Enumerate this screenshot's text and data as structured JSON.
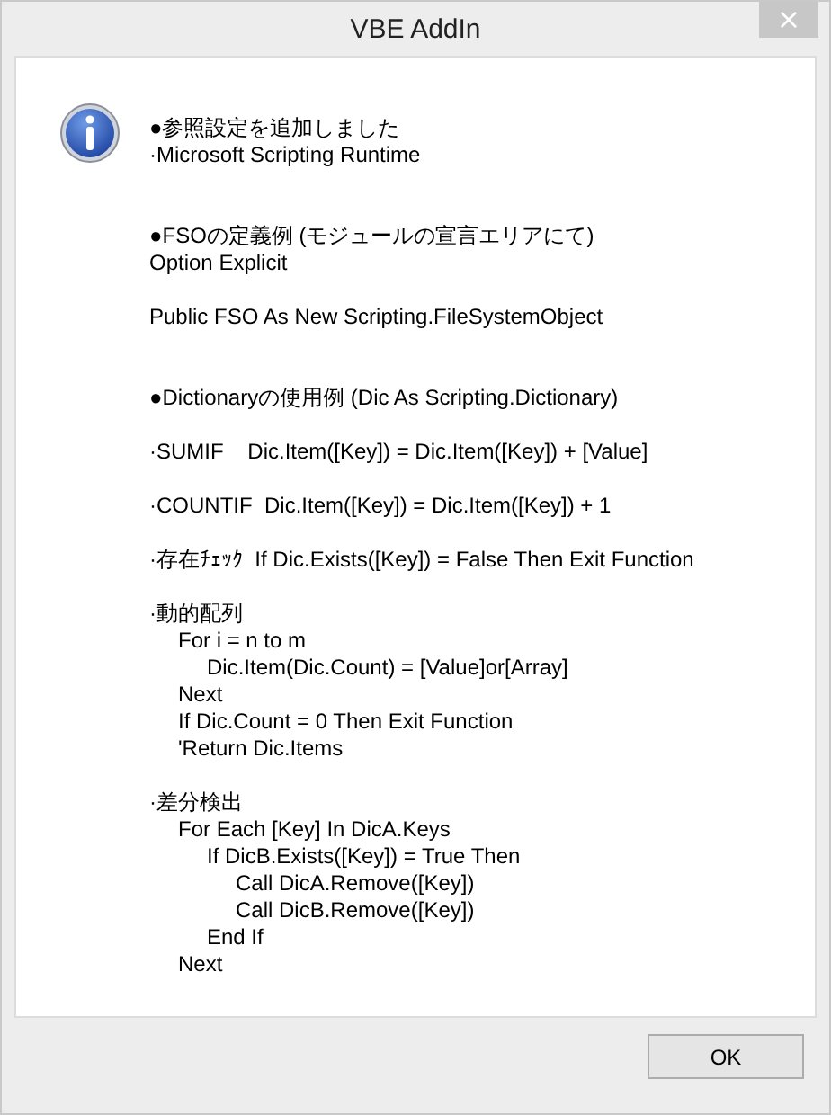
{
  "window": {
    "title": "VBE AddIn",
    "close": "×"
  },
  "message": {
    "sections": [
      {
        "paragraphs": [
          [
            {
              "text": "●参照設定を追加しました"
            },
            {
              "text": "·Microsoft Scripting Runtime"
            }
          ]
        ]
      },
      {
        "paragraphs": [
          [
            {
              "text": "●FSOの定義例 (モジュールの宣言エリアにて)"
            },
            {
              "text": "Option Explicit"
            }
          ],
          [
            {
              "text": "Public FSO As New Scripting.FileSystemObject"
            }
          ]
        ]
      },
      {
        "paragraphs": [
          [
            {
              "text": "●Dictionaryの使用例 (Dic As Scripting.Dictionary)"
            }
          ],
          [
            {
              "text": "·SUMIF    Dic.Item([Key]) = Dic.Item([Key]) + [Value]"
            }
          ],
          [
            {
              "text": "·COUNTIF  Dic.Item([Key]) = Dic.Item([Key]) + 1"
            }
          ],
          [
            {
              "text": "·存在ﾁｪｯｸ  If Dic.Exists([Key]) = False Then Exit Function"
            }
          ],
          [
            {
              "text": "·動的配列",
              "children": [
                {
                  "text": "For i = n to m",
                  "children": [
                    {
                      "text": "Dic.Item(Dic.Count) = [Value]or[Array]"
                    }
                  ]
                },
                {
                  "text": "Next"
                },
                {
                  "text": "If Dic.Count = 0 Then Exit Function"
                },
                {
                  "text": "'Return Dic.Items"
                }
              ]
            }
          ],
          [
            {
              "text": "·差分検出",
              "children": [
                {
                  "text": "For Each [Key] In DicA.Keys",
                  "children": [
                    {
                      "text": "If DicB.Exists([Key]) = True Then",
                      "children": [
                        {
                          "text": "Call DicA.Remove([Key])"
                        },
                        {
                          "text": "Call DicB.Remove([Key])"
                        }
                      ]
                    },
                    {
                      "text": "End If"
                    }
                  ]
                },
                {
                  "text": "Next"
                }
              ]
            }
          ]
        ]
      }
    ]
  },
  "buttons": [
    {
      "label": "OK"
    }
  ]
}
